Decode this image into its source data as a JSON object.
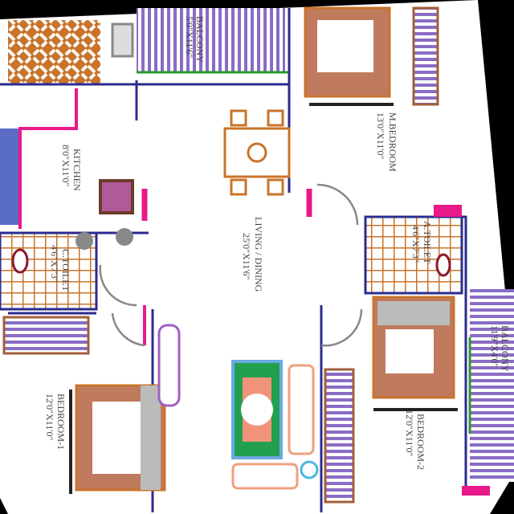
{
  "rooms": {
    "kitchen": {
      "name": "KITCHEN",
      "size": "8'0\"X11'0\""
    },
    "living": {
      "name": "LIVING / DINING",
      "size": "25'0\"X11'6\""
    },
    "master_bedroom": {
      "name": "M.BEDROOM",
      "size": "13'0\"X11'0\""
    },
    "attached_toilet": {
      "name": "A.TOILET",
      "size": "4'6\"X7'3\""
    },
    "common_toilet": {
      "name": "C.TOILET",
      "size": "4'6\"X7'3\""
    },
    "bedroom1": {
      "name": "BEDROOM-1",
      "size": "12'0\"X11'0\""
    },
    "bedroom2": {
      "name": "BEDROOM-2",
      "size": "12'0\"X11'0\""
    },
    "balcony_right": {
      "name": "BALCONY",
      "size": "11'9\"X4'0\""
    },
    "balcony_top": {
      "name": "BALCONY",
      "size": "5'0\"X11'6\""
    }
  },
  "colors": {
    "wall": "#2b2b8f",
    "door_jamb": "#e8198b",
    "furniture": "#c9742a",
    "balcony": "#8a6cc4",
    "background": "#ffffff"
  }
}
